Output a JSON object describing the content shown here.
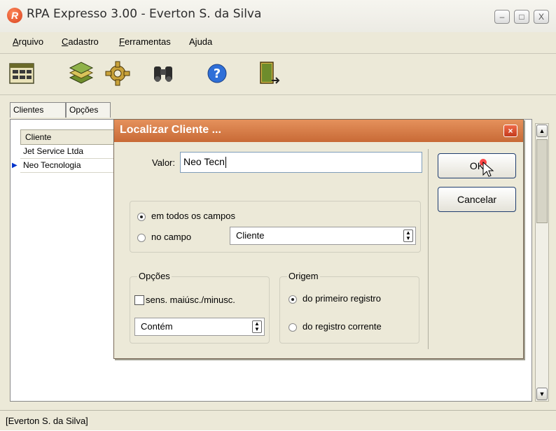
{
  "window": {
    "title": "RPA Expresso 3.00 - Everton S. da Silva",
    "logo_letter": "R",
    "minimize_label": "–",
    "maximize_label": "□",
    "close_label": "X"
  },
  "menu": [
    {
      "key": "A",
      "rest": "rquivo"
    },
    {
      "key": "C",
      "rest": "adastro"
    },
    {
      "key": "F",
      "rest": "erramentas"
    },
    {
      "pre": "A",
      "key": "j",
      "rest": "uda"
    }
  ],
  "toolbar": {
    "icons": [
      "calendar-icon",
      "stack-icon",
      "gear-icon",
      "binoculars-icon",
      "help-icon",
      "exit-door-icon"
    ]
  },
  "tabs": [
    "Clientes",
    "Opções"
  ],
  "grid": {
    "header": "Cliente",
    "rows": [
      "Jet Service Ltda",
      "Neo Tecnologia"
    ],
    "selected_index": 1
  },
  "status": {
    "text": "[Everton S. da Silva]"
  },
  "dialog": {
    "title": "Localizar Cliente ...",
    "close_label": "×",
    "valor_label": "Valor:",
    "valor_value": "Neo Tecn",
    "ok_label": "OK",
    "cancel_label": "Cancelar",
    "scope": {
      "option_all": "em todos os campos",
      "option_field": "no campo",
      "field_value": "Cliente",
      "selected": "all"
    },
    "opcoes": {
      "title": "Opções",
      "case_label": "sens. maiúsc./minusc.",
      "case_checked": false,
      "match_value": "Contém"
    },
    "origem": {
      "title": "Origem",
      "option_first": "do primeiro registro",
      "option_current": "do registro corrente",
      "selected": "first"
    }
  }
}
